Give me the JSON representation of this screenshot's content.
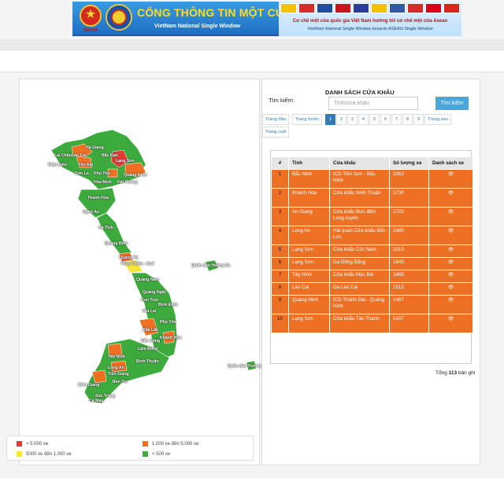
{
  "banner": {
    "emblem_caption": "VNNSW",
    "title": "CỔNG THÔNG TIN MỘT CỬA QUỐC GIA",
    "subtitle": "VietNam National Single Window",
    "right_line1": "Cơ chế một cửa quốc gia Việt Nam hướng tới cơ chế một cửa Asean",
    "right_line2": "VietNam National Single Window towards ASEAN Single Window",
    "flag_colors": [
      "#f3c300",
      "#d62b2b",
      "#1f4ea1",
      "#c9151e",
      "#2a3d9a",
      "#f3c300",
      "#3358a6",
      "#d62b2b",
      "#d8001a",
      "#da251d"
    ]
  },
  "map": {
    "provinces": [
      "Hà Giang",
      "Lai Châu",
      "Lào Cai",
      "Bắc Kạn",
      "Điện Biên",
      "Yên Bái",
      "Lạng Sơn",
      "Sơn La",
      "Phú Thọ",
      "Quảng Ninh",
      "Hòa Bình",
      "Hải Phòng",
      "Thanh Hóa",
      "Nghệ An",
      "Hà Tĩnh",
      "Quảng Bình",
      "Quảng Trị",
      "Thừa Thiên - Huế",
      "Quảng Nam",
      "Quảng Ngãi",
      "Kon Tum",
      "Bình Định",
      "Gia Lai",
      "Phú Yên",
      "Đắk Lắk",
      "Khánh Hòa",
      "Đắc Nông",
      "Lâm Đồng",
      "Bình Thuận",
      "Tây Ninh",
      "Long An",
      "Tiền Giang",
      "Bến Tre",
      "Kiên Giang",
      "Sóc Trăng",
      "Cà Mau",
      "Quần đảo Hoàng Sa",
      "Quần đảo Trường Sa"
    ],
    "colors": {
      "high": "#e53935",
      "mid": "#f07023",
      "low_yellow": "#f5e63a",
      "low": "#3daa3d"
    }
  },
  "legend": {
    "high": "> 5.000 xe",
    "mid": "1.000 xe đến 5.000 xe",
    "yellow": "5000 xe đến 1.000 xe",
    "low": "< 500 xe"
  },
  "list": {
    "title": "DANH SÁCH CỬA KHẨU",
    "search_label": "Tìm kiếm:",
    "search_placeholder": "Tỉnh/cửa khẩu",
    "search_button": "Tìm kiếm",
    "pager": {
      "first": "Trang đầu",
      "prev": "Trang trước",
      "pages": [
        "1",
        "2",
        "3",
        "4",
        "5",
        "6",
        "7",
        "8",
        "9"
      ],
      "next": "Trang sau",
      "last": "Trang cuối",
      "active_page": "1"
    },
    "columns": [
      "#",
      "Tỉnh",
      "Cửa khẩu",
      "Số lượng xe",
      "Danh sách xe"
    ],
    "rows": [
      {
        "n": "1",
        "province": "Bắc Ninh",
        "gate": "ICD Tiên Sơn - Bắc Ninh",
        "count": "3262"
      },
      {
        "n": "2",
        "province": "Khánh Hòa",
        "gate": "Cửa khẩu Ninh Thuận",
        "count": "2730"
      },
      {
        "n": "3",
        "province": "An Giang",
        "gate": "Cửa khẩu Bưu điện Long xuyên",
        "count": "2722"
      },
      {
        "n": "4",
        "province": "Long An",
        "gate": "Hải quan Cửa khẩu Bến Lức",
        "count": "2480"
      },
      {
        "n": "5",
        "province": "Lạng Sơn",
        "gate": "Cửa khẩu Cốc Nam",
        "count": "2010"
      },
      {
        "n": "6",
        "province": "Lạng Sơn",
        "gate": "Ga Đồng Đăng",
        "count": "1845"
      },
      {
        "n": "7",
        "province": "Tây Ninh",
        "gate": "Cửa khẩu Mộc Bài",
        "count": "1665"
      },
      {
        "n": "8",
        "province": "Lào Cai",
        "gate": "Ga Lào Cai",
        "count": "1515"
      },
      {
        "n": "9",
        "province": "Quảng Ninh",
        "gate": "ICD Thành Đạt - Quảng Ninh",
        "count": "1467"
      },
      {
        "n": "10",
        "province": "Lạng Sơn",
        "gate": "Cửa khẩu Tân Thanh",
        "count": "1437"
      }
    ],
    "view_icon": "eye-icon",
    "total_prefix": "Tổng",
    "total_count": "113",
    "total_suffix": "bản ghi"
  }
}
